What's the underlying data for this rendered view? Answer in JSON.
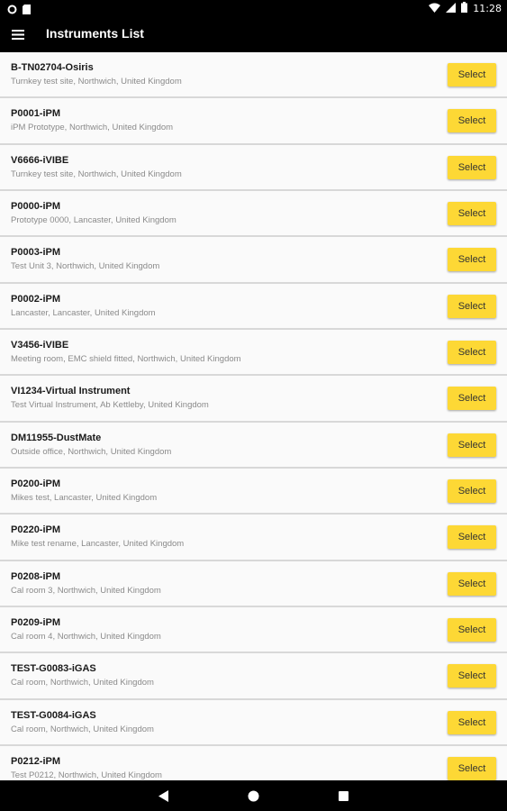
{
  "status_bar": {
    "time": "11:28",
    "icons": [
      "settings-icon",
      "sd-card-icon",
      "wifi-icon",
      "signal-icon",
      "battery-icon"
    ]
  },
  "app_bar": {
    "title": "Instruments List",
    "menu_icon": "hamburger-menu-icon"
  },
  "button_label": "Select",
  "accent_color": "#fdd835",
  "instruments": [
    {
      "name": "B-TN02704-Osiris",
      "location": "Turnkey test site, Northwich, United Kingdom"
    },
    {
      "name": "P0001-iPM",
      "location": "iPM Prototype, Northwich, United Kingdom"
    },
    {
      "name": "V6666-iVIBE",
      "location": "Turnkey test site, Northwich, United Kingdom"
    },
    {
      "name": "P0000-iPM",
      "location": "Prototype 0000, Lancaster, United Kingdom"
    },
    {
      "name": "P0003-iPM",
      "location": "Test Unit 3, Northwich, United Kingdom"
    },
    {
      "name": "P0002-iPM",
      "location": "Lancaster, Lancaster, United Kingdom"
    },
    {
      "name": "V3456-iVIBE",
      "location": "Meeting room, EMC shield fitted, Northwich, United Kingdom"
    },
    {
      "name": "VI1234-Virtual Instrument",
      "location": "Test Virtual Instrument, Ab Kettleby, United Kingdom"
    },
    {
      "name": "DM11955-DustMate",
      "location": "Outside office, Northwich, United Kingdom"
    },
    {
      "name": "P0200-iPM",
      "location": "Mikes test, Lancaster, United Kingdom"
    },
    {
      "name": "P0220-iPM",
      "location": "Mike test rename, Lancaster, United Kingdom"
    },
    {
      "name": "P0208-iPM",
      "location": "Cal room 3, Northwich, United Kingdom"
    },
    {
      "name": "P0209-iPM",
      "location": "Cal room 4, Northwich, United Kingdom"
    },
    {
      "name": "TEST-G0083-iGAS",
      "location": "Cal room, Northwich, United Kingdom"
    },
    {
      "name": "TEST-G0084-iGAS",
      "location": "Cal room, Northwich, United Kingdom"
    },
    {
      "name": "P0212-iPM",
      "location": "Test P0212, Northwich, United Kingdom"
    }
  ],
  "nav_bar": {
    "buttons": [
      "back-icon",
      "home-icon",
      "recents-icon"
    ]
  }
}
